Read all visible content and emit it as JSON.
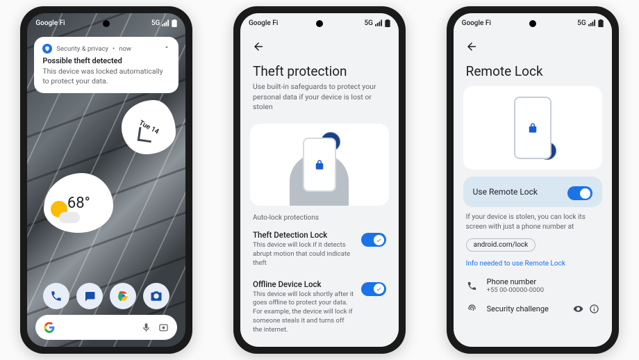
{
  "status": {
    "carrier": "Google Fi",
    "network": "5G"
  },
  "phone1": {
    "notification": {
      "source": "Security & privacy",
      "when": "now",
      "title": "Possible theft detected",
      "body": "This device was locked automatically to protect your data."
    },
    "date": "Tue 14",
    "weather": {
      "temp": "68°"
    },
    "search": {
      "label": "G"
    },
    "dock": [
      "phone-icon",
      "messages-icon",
      "chrome-icon",
      "camera-icon"
    ]
  },
  "phone2": {
    "title": "Theft protection",
    "subtitle": "Use built-in safeguards to protect your personal data if your device is lost or stolen",
    "section": "Auto-lock protections",
    "settings": [
      {
        "title": "Theft Detection Lock",
        "desc": "This device will lock if it detects abrupt motion that could indicate theft"
      },
      {
        "title": "Offline Device Lock",
        "desc": "This device will lock shortly after it goes offline to protect your data. For example, the device will lock if someone steals it and turns off the internet."
      }
    ]
  },
  "phone3": {
    "title": "Remote Lock",
    "toggle_label": "Use Remote Lock",
    "note": "If your device is stolen, you can lock its screen with just a phone number at",
    "link": "android.com/lock",
    "info_link": "Info needed to use Remote Lock",
    "phone_row": {
      "title": "Phone number",
      "value": "+55 00-00000-0000"
    },
    "security_row": {
      "title": "Security challenge"
    }
  }
}
